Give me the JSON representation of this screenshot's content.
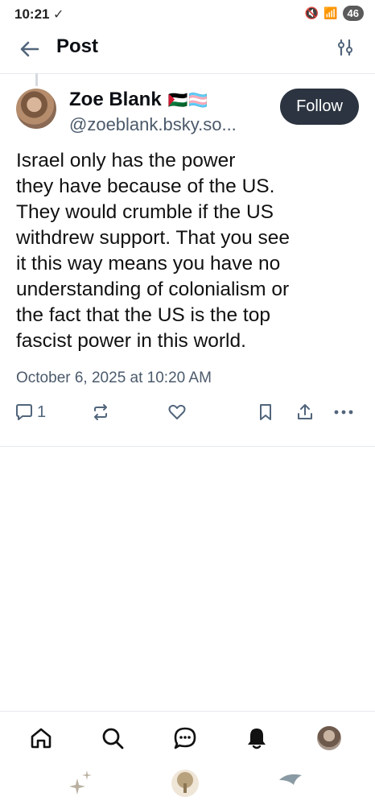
{
  "status_bar": {
    "time": "10:21",
    "battery": "46"
  },
  "header": {
    "title": "Post"
  },
  "post": {
    "author_name": "Zoe Blank",
    "author_flags": "🇵🇸🏳️‍⚧️",
    "handle": "@zoeblank.bsky.so...",
    "follow_label": "Follow",
    "text": "Israel only has the power\nthey have because of the US.\nThey would crumble if the US\nwithdrew support. That you see\nit this way means you have no\nunderstanding of colonialism or\nthe fact that the US is the top\nfascist power in this world.",
    "timestamp": "October 6, 2025 at 10:20 AM",
    "reply_count": "1"
  },
  "icons": {
    "back": "back-arrow-icon",
    "filter": "sliders-icon",
    "reply": "comment-icon",
    "repost": "repost-icon",
    "like": "heart-icon",
    "bookmark": "bookmark-icon",
    "share": "share-icon",
    "more": "more-icon"
  },
  "colors": {
    "accent": "#2b3440",
    "muted": "#51657b"
  }
}
